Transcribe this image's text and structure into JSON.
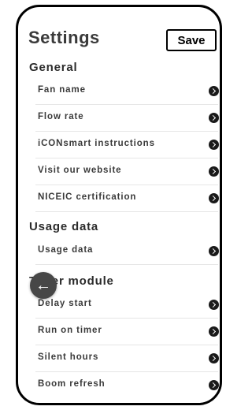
{
  "header": {
    "title": "Settings",
    "save_label": "Save"
  },
  "sections": [
    {
      "title": "General",
      "items": [
        "Fan name",
        "Flow rate",
        "iCONsmart instructions",
        "Visit our website",
        "NICEIC certification"
      ]
    },
    {
      "title": "Usage data",
      "items": [
        "Usage data"
      ]
    },
    {
      "title": "Timer module",
      "items": [
        "Delay start",
        "Run on timer",
        "Silent hours",
        "Boom refresh"
      ]
    }
  ],
  "icons": {
    "chevron": "chevron-right-circle-icon",
    "back": "arrow-left-icon"
  },
  "back_glyph": "←"
}
